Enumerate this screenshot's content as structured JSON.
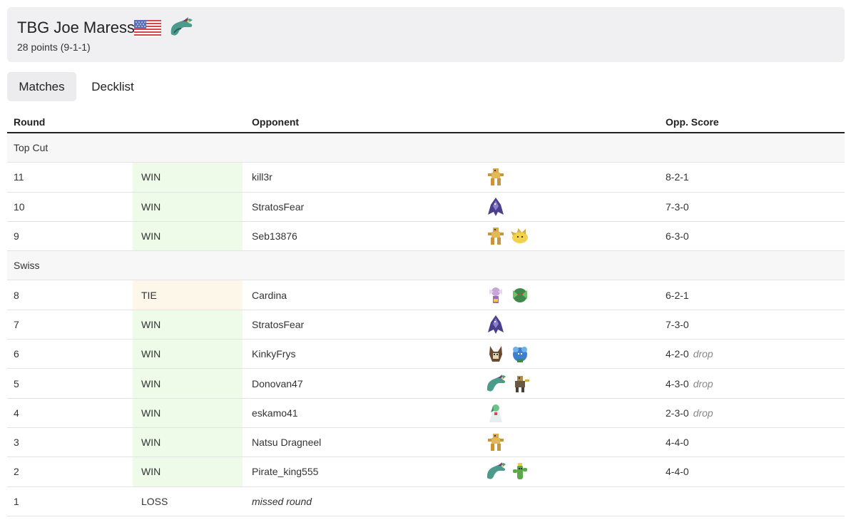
{
  "player": {
    "name": "TBG Joe Maressa",
    "points": "28 points (9-1-1)",
    "flag_icon": "us-flag-icon",
    "deck_icon": "dragapult-sprite-icon"
  },
  "tabs": [
    {
      "label": "Matches",
      "active": true
    },
    {
      "label": "Decklist",
      "active": false
    }
  ],
  "table": {
    "headers": {
      "round": "Round",
      "opponent": "Opponent",
      "score": "Opp. Score"
    },
    "sections": [
      {
        "label": "Top Cut",
        "rows": [
          {
            "round": "11",
            "result": "WIN",
            "opponent": "kill3r",
            "deck": [
              "regidrago"
            ],
            "score": "8-2-1",
            "drop": ""
          },
          {
            "round": "10",
            "result": "WIN",
            "opponent": "StratosFear",
            "deck": [
              "dark-beast"
            ],
            "score": "7-3-0",
            "drop": ""
          },
          {
            "round": "9",
            "result": "WIN",
            "opponent": "Seb13876",
            "deck": [
              "regidrago",
              "yellow-blob"
            ],
            "score": "6-3-0",
            "drop": ""
          }
        ]
      },
      {
        "label": "Swiss",
        "rows": [
          {
            "round": "8",
            "result": "TIE",
            "opponent": "Cardina",
            "deck": [
              "purple-fairy",
              "green-leaf"
            ],
            "score": "6-2-1",
            "drop": ""
          },
          {
            "round": "7",
            "result": "WIN",
            "opponent": "StratosFear",
            "deck": [
              "dark-beast"
            ],
            "score": "7-3-0",
            "drop": ""
          },
          {
            "round": "6",
            "result": "WIN",
            "opponent": "KinkyFrys",
            "deck": [
              "brown-fox",
              "blue-plant"
            ],
            "score": "4-2-0",
            "drop": "drop"
          },
          {
            "round": "5",
            "result": "WIN",
            "opponent": "Donovan47",
            "deck": [
              "dragapult",
              "brown-warrior"
            ],
            "score": "4-3-0",
            "drop": "drop"
          },
          {
            "round": "4",
            "result": "WIN",
            "opponent": "eskamo41",
            "deck": [
              "gardevoir"
            ],
            "score": "2-3-0",
            "drop": "drop"
          },
          {
            "round": "3",
            "result": "WIN",
            "opponent": "Natsu Dragneel",
            "deck": [
              "regidrago"
            ],
            "score": "4-4-0",
            "drop": ""
          },
          {
            "round": "2",
            "result": "WIN",
            "opponent": "Pirate_king555",
            "deck": [
              "dragapult",
              "green-cactus"
            ],
            "score": "4-4-0",
            "drop": ""
          },
          {
            "round": "1",
            "result": "LOSS",
            "opponent": "missed round",
            "deck": [],
            "score": "",
            "drop": ""
          }
        ]
      }
    ]
  },
  "colors": {
    "win_bg": "#eefbe9",
    "tie_bg": "#fdf7ea",
    "header_bg": "#f0f0f2"
  }
}
